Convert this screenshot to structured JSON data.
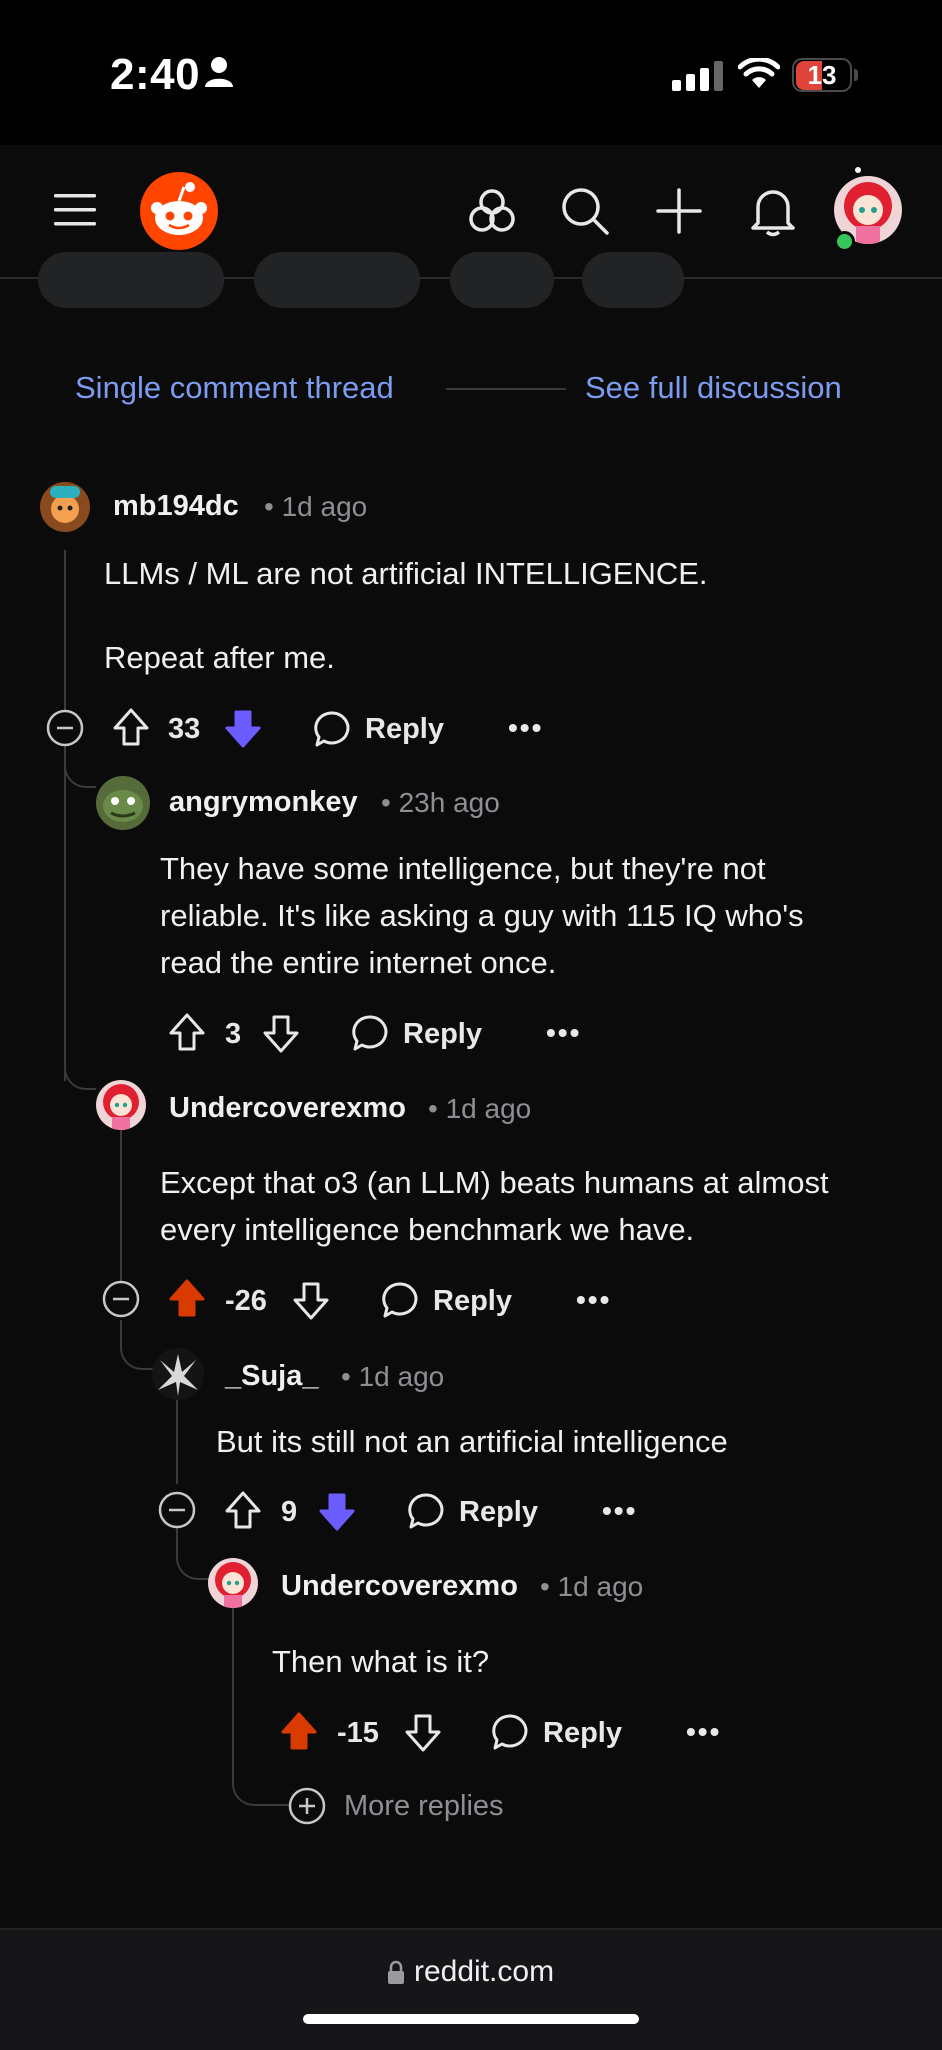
{
  "status": {
    "time": "2:40",
    "battery": "13"
  },
  "thread": {
    "single_label": "Single comment thread",
    "full_label": "See full discussion"
  },
  "comments": [
    {
      "user": "mb194dc",
      "time": "• 1d ago",
      "lines": [
        "LLMs / ML are not artificial INTELLIGENCE.",
        "Repeat after me."
      ],
      "score": "33",
      "vote": "down"
    },
    {
      "user": "angrymonkey",
      "time": "• 23h ago",
      "lines": [
        "They have some intelligence, but they're not",
        "reliable. It's like asking a guy with 115 IQ who's",
        "read the entire internet once."
      ],
      "score": "3",
      "vote": "none"
    },
    {
      "user": "Undercoverexmo",
      "time": "• 1d ago",
      "lines": [
        "Except that o3 (an LLM) beats humans at almost",
        "every intelligence benchmark we have."
      ],
      "score": "-26",
      "vote": "up"
    },
    {
      "user": "_Suja_",
      "time": "• 1d ago",
      "lines": [
        "But its still not an artificial intelligence"
      ],
      "score": "9",
      "vote": "down"
    },
    {
      "user": "Undercoverexmo",
      "time": "• 1d ago",
      "lines": [
        "Then what is it?"
      ],
      "score": "-15",
      "vote": "up"
    }
  ],
  "labels": {
    "reply": "Reply",
    "more": "•••",
    "more_replies": "More replies"
  },
  "footer": {
    "url": "reddit.com"
  },
  "colors": {
    "upvote": "#d93a00",
    "downvote": "#6a5cff",
    "link": "#7c9cf0"
  },
  "icons": [
    "hamburger-menu-icon",
    "reddit-logo",
    "communities-icon",
    "search-icon",
    "create-post-icon",
    "notifications-icon",
    "user-avatar",
    "upvote-icon",
    "downvote-icon",
    "reply-bubble-icon",
    "collapse-icon",
    "expand-icon",
    "lock-icon"
  ]
}
